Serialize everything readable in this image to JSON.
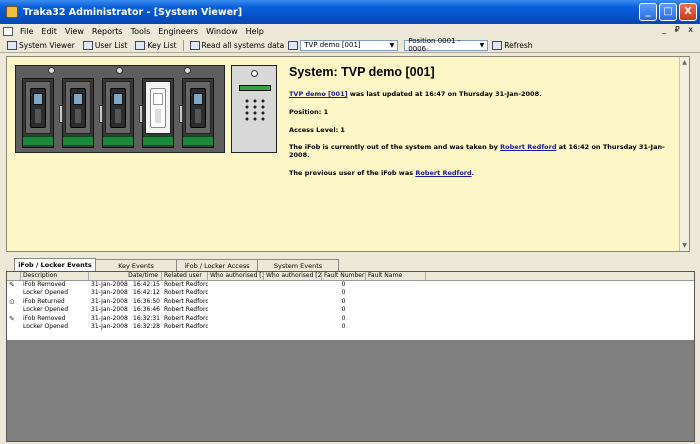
{
  "window": {
    "title": "Traka32 Administrator - [System Viewer]",
    "controls": [
      "_",
      "□",
      "X"
    ]
  },
  "menubar": {
    "items": [
      "File",
      "Edit",
      "View",
      "Reports",
      "Tools",
      "Engineers",
      "Window",
      "Help"
    ],
    "mdi_controls": "_ ₽ x"
  },
  "toolbar": {
    "system_viewer": "System Viewer",
    "user_list": "User List",
    "key_list": "Key List",
    "read_all": "Read all systems data",
    "system_combo": "TVP demo [001]",
    "position_combo": "Position 0001 - 0006",
    "refresh": "Refresh"
  },
  "info": {
    "title": "System: TVP demo [001]",
    "updated_link": "TVP demo [001]",
    "updated_text": "was last updated at 16:47 on Thursday 31-Jan-2008.",
    "position": "Position: 1",
    "access_level": "Access Level: 1",
    "out_text": "The iFob is currently out of the system and was taken by",
    "out_user": "Robert Redford",
    "out_time": "at 16:42 on Thursday 31-Jan-2008.",
    "prev_text": "The previous user of the iFob was",
    "prev_user": "Robert Redford",
    "prev_end": "."
  },
  "tabs": [
    {
      "label": "iFob / Locker Events",
      "active": true
    },
    {
      "label": "Key Events",
      "active": false
    },
    {
      "label": "iFob / Locker Access",
      "active": false
    },
    {
      "label": "System Events",
      "active": false
    }
  ],
  "grid": {
    "headers": [
      "",
      "Description",
      "Date/time",
      "Related user",
      "Who authorised [1]",
      "Who authorised [2]",
      "Fault Number",
      "Fault Name"
    ],
    "rows": [
      {
        "icon": "removed",
        "description": "iFob Removed",
        "date": "31-Jan-2008",
        "time": "16:42:15",
        "user": "Robert Redford",
        "auth1": "",
        "auth2": "",
        "fault_number": "0",
        "fault_name": ""
      },
      {
        "icon": "",
        "description": "Locker Opened",
        "date": "31-Jan-2008",
        "time": "16:42:12",
        "user": "Robert Redford",
        "auth1": "",
        "auth2": "",
        "fault_number": "0",
        "fault_name": ""
      },
      {
        "icon": "returned",
        "description": "iFob Returned",
        "date": "31-Jan-2008",
        "time": "16:36:50",
        "user": "Robert Redford",
        "auth1": "",
        "auth2": "",
        "fault_number": "0",
        "fault_name": ""
      },
      {
        "icon": "",
        "description": "Locker Opened",
        "date": "31-Jan-2008",
        "time": "16:36:46",
        "user": "Robert Redford",
        "auth1": "",
        "auth2": "",
        "fault_number": "0",
        "fault_name": ""
      },
      {
        "icon": "removed",
        "description": "iFob Removed",
        "date": "31-Jan-2008",
        "time": "16:32:31",
        "user": "Robert Redford",
        "auth1": "",
        "auth2": "",
        "fault_number": "0",
        "fault_name": ""
      },
      {
        "icon": "",
        "description": "Locker Opened",
        "date": "31-Jan-2008",
        "time": "16:32:28",
        "user": "Robert Redford",
        "auth1": "",
        "auth2": "",
        "fault_number": "0",
        "fault_name": ""
      }
    ]
  },
  "colors": {
    "title_bar": "#0550c8",
    "info_panel": "#fdf6c6",
    "chrome": "#ece9d8",
    "lock_green": "#1a8a3a",
    "link": "#1a1a9a"
  }
}
